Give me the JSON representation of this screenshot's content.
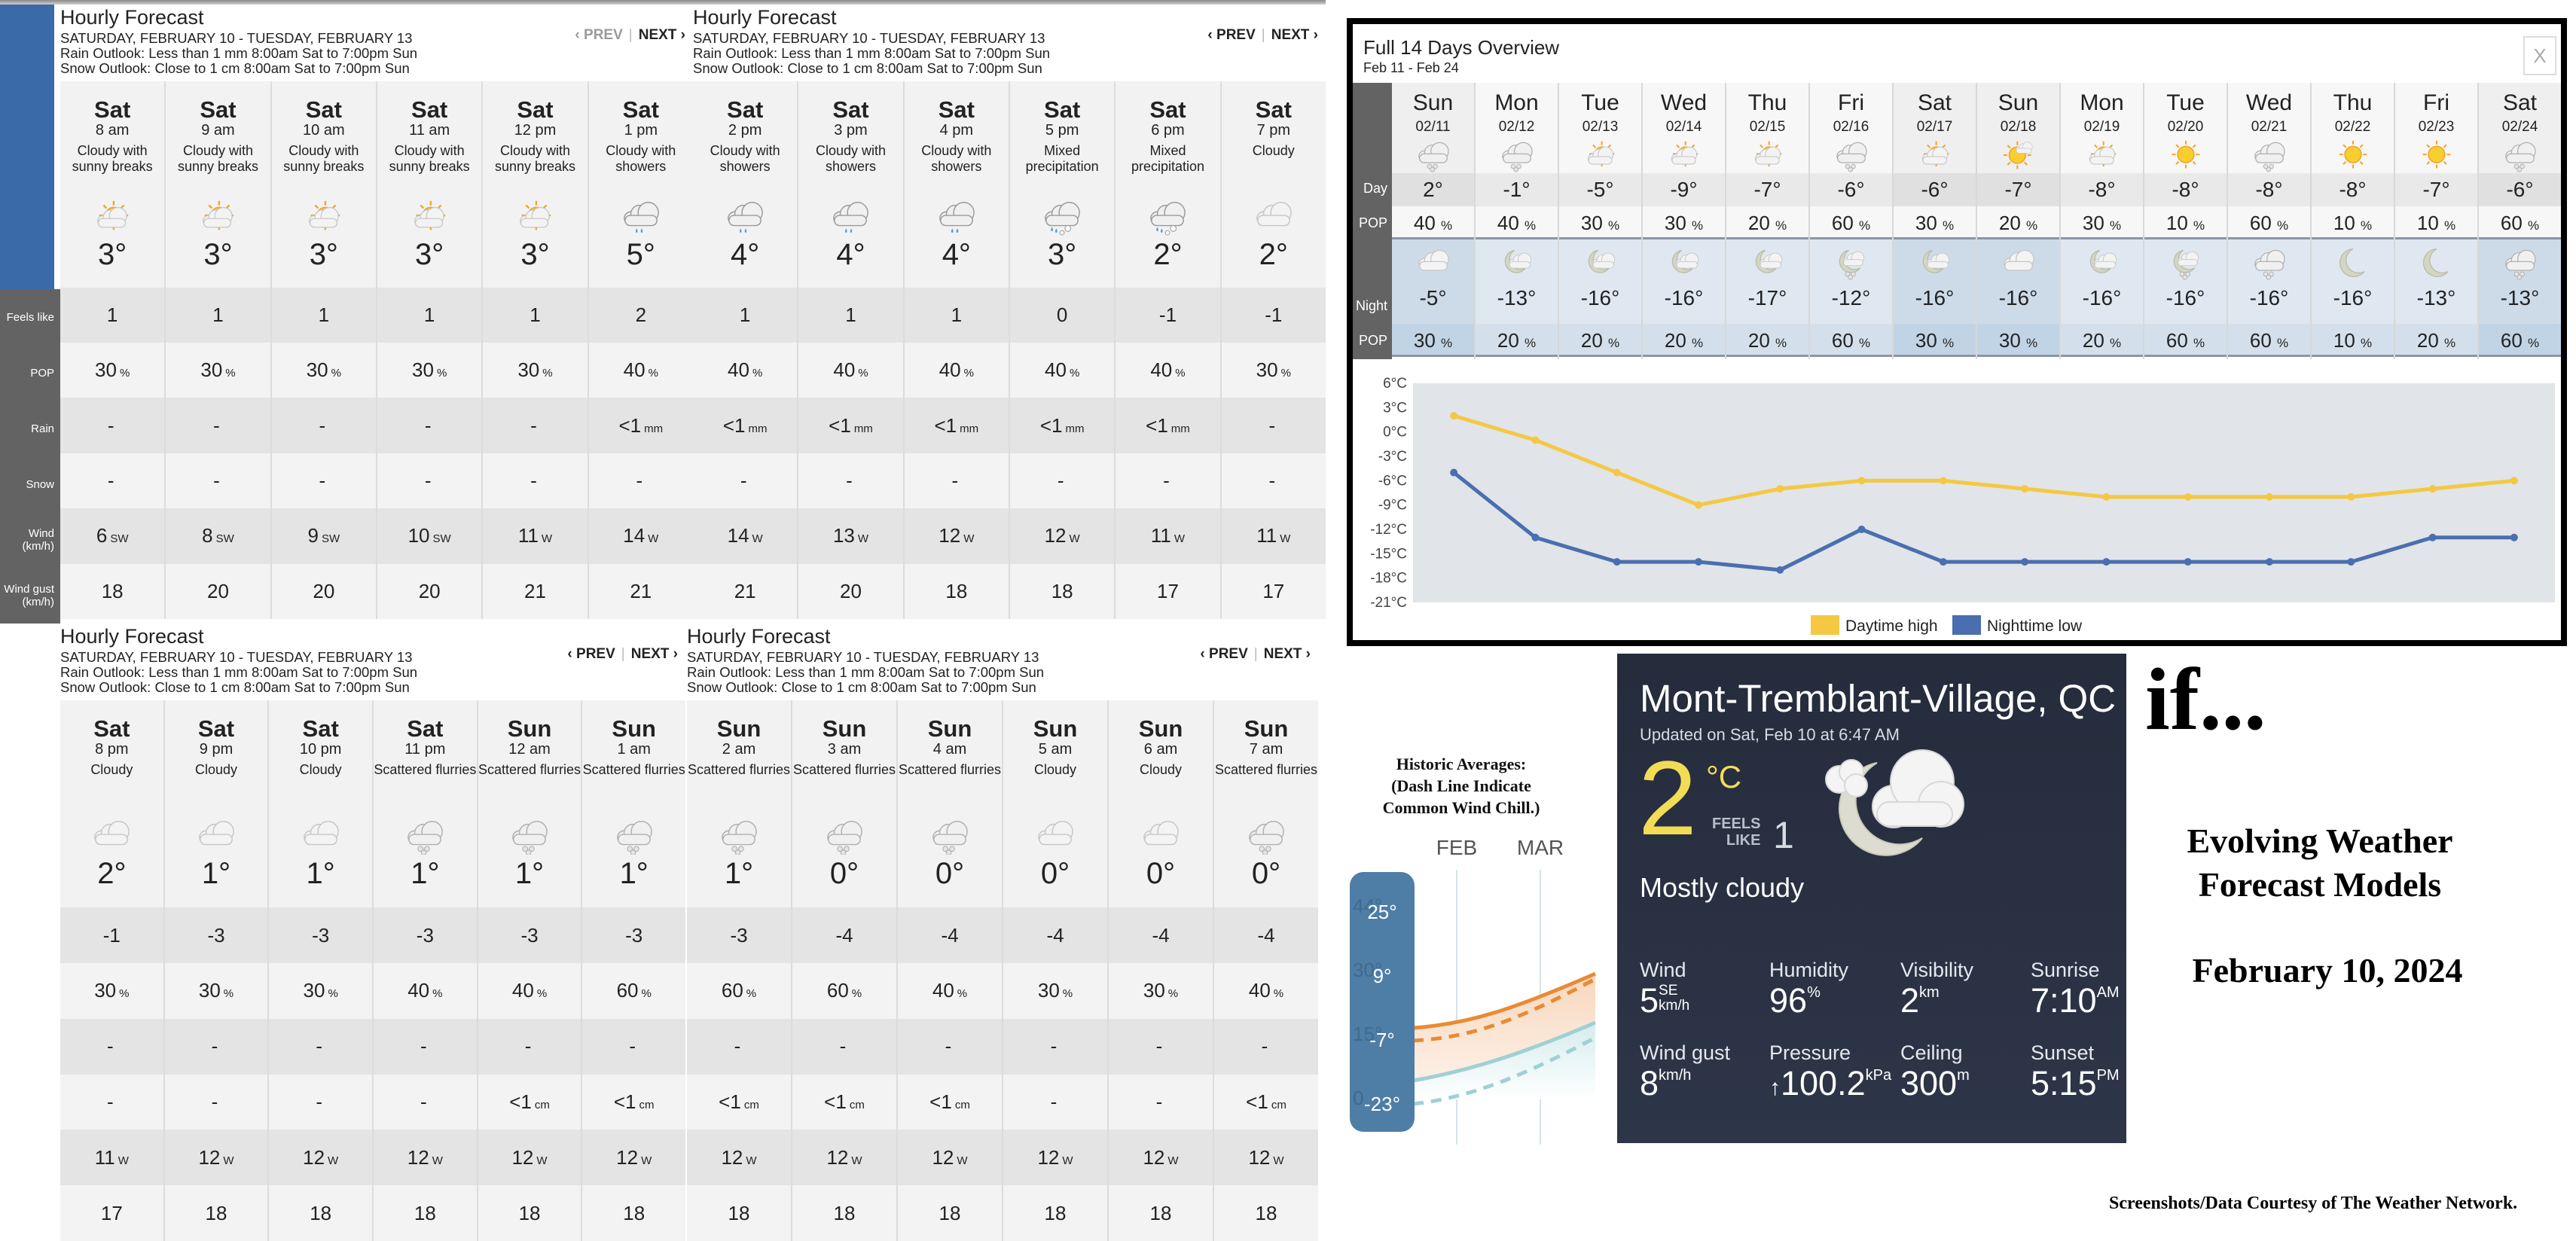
{
  "hourly_panels": [
    {
      "title": "Hourly Forecast",
      "date_range": "SATURDAY, FEBRUARY 10 - TUESDAY, FEBRUARY 13",
      "rain_outlook": "Rain Outlook: Less than 1 mm 8:00am Sat to 7:00pm Sun",
      "snow_outlook": "Snow Outlook: Close to 1 cm 8:00am Sat to 7:00pm Sun",
      "prev_label": "‹ PREV",
      "next_label": "NEXT ›",
      "prev_disabled": true,
      "hours": [
        {
          "day": "Sat",
          "time": "8 am",
          "condition": "Cloudy with\nsunny breaks",
          "icon": "partly-sunny-icon",
          "temp": "3°",
          "feels": "1",
          "pop": "30",
          "rain": "-",
          "rain_unit": "",
          "snow": "-",
          "snow_unit": "",
          "wind": "6",
          "wind_dir": "SW",
          "gust": "18"
        },
        {
          "day": "Sat",
          "time": "9 am",
          "condition": "Cloudy with\nsunny breaks",
          "icon": "partly-sunny-icon",
          "temp": "3°",
          "feels": "1",
          "pop": "30",
          "rain": "-",
          "rain_unit": "",
          "snow": "-",
          "snow_unit": "",
          "wind": "8",
          "wind_dir": "SW",
          "gust": "20"
        },
        {
          "day": "Sat",
          "time": "10 am",
          "condition": "Cloudy with\nsunny breaks",
          "icon": "partly-sunny-icon",
          "temp": "3°",
          "feels": "1",
          "pop": "30",
          "rain": "-",
          "rain_unit": "",
          "snow": "-",
          "snow_unit": "",
          "wind": "9",
          "wind_dir": "SW",
          "gust": "20"
        },
        {
          "day": "Sat",
          "time": "11 am",
          "condition": "Cloudy with\nsunny breaks",
          "icon": "partly-sunny-icon",
          "temp": "3°",
          "feels": "1",
          "pop": "30",
          "rain": "-",
          "rain_unit": "",
          "snow": "-",
          "snow_unit": "",
          "wind": "10",
          "wind_dir": "SW",
          "gust": "20"
        },
        {
          "day": "Sat",
          "time": "12 pm",
          "condition": "Cloudy with\nsunny breaks",
          "icon": "partly-sunny-icon",
          "temp": "3°",
          "feels": "1",
          "pop": "30",
          "rain": "-",
          "rain_unit": "",
          "snow": "-",
          "snow_unit": "",
          "wind": "11",
          "wind_dir": "W",
          "gust": "21"
        },
        {
          "day": "Sat",
          "time": "1 pm",
          "condition": "Cloudy with\nshowers",
          "icon": "rain-cloud-icon",
          "temp": "5°",
          "feels": "2",
          "pop": "40",
          "rain": "<1",
          "rain_unit": "mm",
          "snow": "-",
          "snow_unit": "",
          "wind": "14",
          "wind_dir": "W",
          "gust": "21"
        }
      ]
    },
    {
      "title": "Hourly Forecast",
      "date_range": "SATURDAY, FEBRUARY 10 - TUESDAY, FEBRUARY 13",
      "rain_outlook": "Rain Outlook: Less than 1 mm 8:00am Sat to 7:00pm Sun",
      "snow_outlook": "Snow Outlook: Close to 1 cm 8:00am Sat to 7:00pm Sun",
      "prev_label": "‹ PREV",
      "next_label": "NEXT ›",
      "prev_disabled": false,
      "hours": [
        {
          "day": "Sat",
          "time": "2 pm",
          "condition": "Cloudy with\nshowers",
          "icon": "rain-cloud-icon",
          "temp": "4°",
          "feels": "1",
          "pop": "40",
          "rain": "<1",
          "rain_unit": "mm",
          "snow": "-",
          "snow_unit": "",
          "wind": "14",
          "wind_dir": "W",
          "gust": "21"
        },
        {
          "day": "Sat",
          "time": "3 pm",
          "condition": "Cloudy with\nshowers",
          "icon": "rain-cloud-icon",
          "temp": "4°",
          "feels": "1",
          "pop": "40",
          "rain": "<1",
          "rain_unit": "mm",
          "snow": "-",
          "snow_unit": "",
          "wind": "13",
          "wind_dir": "W",
          "gust": "20"
        },
        {
          "day": "Sat",
          "time": "4 pm",
          "condition": "Cloudy with\nshowers",
          "icon": "rain-cloud-icon",
          "temp": "4°",
          "feels": "1",
          "pop": "40",
          "rain": "<1",
          "rain_unit": "mm",
          "snow": "-",
          "snow_unit": "",
          "wind": "12",
          "wind_dir": "W",
          "gust": "18"
        },
        {
          "day": "Sat",
          "time": "5 pm",
          "condition": "Mixed\nprecipitation",
          "icon": "mixed-precip-icon",
          "temp": "3°",
          "feels": "0",
          "pop": "40",
          "rain": "<1",
          "rain_unit": "mm",
          "snow": "-",
          "snow_unit": "",
          "wind": "12",
          "wind_dir": "W",
          "gust": "18"
        },
        {
          "day": "Sat",
          "time": "6 pm",
          "condition": "Mixed\nprecipitation",
          "icon": "mixed-precip-icon",
          "temp": "2°",
          "feels": "-1",
          "pop": "40",
          "rain": "<1",
          "rain_unit": "mm",
          "snow": "-",
          "snow_unit": "",
          "wind": "11",
          "wind_dir": "W",
          "gust": "17"
        },
        {
          "day": "Sat",
          "time": "7 pm",
          "condition": "Cloudy",
          "icon": "cloud-icon",
          "temp": "2°",
          "feels": "-1",
          "pop": "30",
          "rain": "-",
          "rain_unit": "",
          "snow": "-",
          "snow_unit": "",
          "wind": "11",
          "wind_dir": "W",
          "gust": "17"
        }
      ]
    },
    {
      "title": "Hourly Forecast",
      "date_range": "SATURDAY, FEBRUARY 10 - TUESDAY, FEBRUARY 13",
      "rain_outlook": "Rain Outlook: Less than 1 mm 8:00am Sat to 7:00pm Sun",
      "snow_outlook": "Snow Outlook: Close to 1 cm 8:00am Sat to 7:00pm Sun",
      "prev_label": "‹ PREV",
      "next_label": "NEXT ›",
      "prev_disabled": false,
      "hours": [
        {
          "day": "Sat",
          "time": "8 pm",
          "condition": "Cloudy",
          "icon": "cloud-icon",
          "temp": "2°",
          "feels": "-1",
          "pop": "30",
          "rain": "-",
          "rain_unit": "",
          "snow": "-",
          "snow_unit": "",
          "wind": "11",
          "wind_dir": "W",
          "gust": "17"
        },
        {
          "day": "Sat",
          "time": "9 pm",
          "condition": "Cloudy",
          "icon": "cloud-icon",
          "temp": "1°",
          "feels": "-3",
          "pop": "30",
          "rain": "-",
          "rain_unit": "",
          "snow": "-",
          "snow_unit": "",
          "wind": "12",
          "wind_dir": "W",
          "gust": "18"
        },
        {
          "day": "Sat",
          "time": "10 pm",
          "condition": "Cloudy",
          "icon": "cloud-icon",
          "temp": "1°",
          "feels": "-3",
          "pop": "30",
          "rain": "-",
          "rain_unit": "",
          "snow": "-",
          "snow_unit": "",
          "wind": "12",
          "wind_dir": "W",
          "gust": "18"
        },
        {
          "day": "Sat",
          "time": "11 pm",
          "condition": "Scattered flurries",
          "icon": "flurries-icon",
          "temp": "1°",
          "feels": "-3",
          "pop": "40",
          "rain": "-",
          "rain_unit": "",
          "snow": "-",
          "snow_unit": "",
          "wind": "12",
          "wind_dir": "W",
          "gust": "18"
        },
        {
          "day": "Sun",
          "time": "12 am",
          "condition": "Scattered flurries",
          "icon": "flurries-icon",
          "temp": "1°",
          "feels": "-3",
          "pop": "40",
          "rain": "-",
          "rain_unit": "",
          "snow": "<1",
          "snow_unit": "cm",
          "wind": "12",
          "wind_dir": "W",
          "gust": "18"
        },
        {
          "day": "Sun",
          "time": "1 am",
          "condition": "Scattered flurries",
          "icon": "flurries-icon",
          "temp": "1°",
          "feels": "-3",
          "pop": "60",
          "rain": "-",
          "rain_unit": "",
          "snow": "<1",
          "snow_unit": "cm",
          "wind": "12",
          "wind_dir": "W",
          "gust": "18"
        }
      ]
    },
    {
      "title": "Hourly Forecast",
      "date_range": "SATURDAY, FEBRUARY 10 - TUESDAY, FEBRUARY 13",
      "rain_outlook": "Rain Outlook: Less than 1 mm 8:00am Sat to 7:00pm Sun",
      "snow_outlook": "Snow Outlook: Close to 1 cm 8:00am Sat to 7:00pm Sun",
      "prev_label": "‹ PREV",
      "next_label": "NEXT ›",
      "prev_disabled": false,
      "hours": [
        {
          "day": "Sun",
          "time": "2 am",
          "condition": "Scattered flurries",
          "icon": "flurries-icon",
          "temp": "1°",
          "feels": "-3",
          "pop": "60",
          "rain": "-",
          "rain_unit": "",
          "snow": "<1",
          "snow_unit": "cm",
          "wind": "12",
          "wind_dir": "W",
          "gust": "18"
        },
        {
          "day": "Sun",
          "time": "3 am",
          "condition": "Scattered flurries",
          "icon": "flurries-icon",
          "temp": "0°",
          "feels": "-4",
          "pop": "60",
          "rain": "-",
          "rain_unit": "",
          "snow": "<1",
          "snow_unit": "cm",
          "wind": "12",
          "wind_dir": "W",
          "gust": "18"
        },
        {
          "day": "Sun",
          "time": "4 am",
          "condition": "Scattered flurries",
          "icon": "flurries-icon",
          "temp": "0°",
          "feels": "-4",
          "pop": "40",
          "rain": "-",
          "rain_unit": "",
          "snow": "<1",
          "snow_unit": "cm",
          "wind": "12",
          "wind_dir": "W",
          "gust": "18"
        },
        {
          "day": "Sun",
          "time": "5 am",
          "condition": "Cloudy",
          "icon": "cloud-icon",
          "temp": "0°",
          "feels": "-4",
          "pop": "30",
          "rain": "-",
          "rain_unit": "",
          "snow": "-",
          "snow_unit": "",
          "wind": "12",
          "wind_dir": "W",
          "gust": "18"
        },
        {
          "day": "Sun",
          "time": "6 am",
          "condition": "Cloudy",
          "icon": "cloud-icon",
          "temp": "0°",
          "feels": "-4",
          "pop": "30",
          "rain": "-",
          "rain_unit": "",
          "snow": "-",
          "snow_unit": "",
          "wind": "12",
          "wind_dir": "W",
          "gust": "18"
        },
        {
          "day": "Sun",
          "time": "7 am",
          "condition": "Scattered flurries",
          "icon": "flurries-icon",
          "temp": "0°",
          "feels": "-4",
          "pop": "40",
          "rain": "-",
          "rain_unit": "",
          "snow": "<1",
          "snow_unit": "cm",
          "wind": "12",
          "wind_dir": "W",
          "gust": "18"
        }
      ]
    }
  ],
  "row_labels": {
    "feels_like": "Feels like",
    "pop": "POP",
    "rain": "Rain",
    "snow": "Snow",
    "wind": "Wind\n(km/h)",
    "gust": "Wind gust\n(km/h)",
    "pct": "%"
  },
  "overview14": {
    "title": "Full 14 Days Overview",
    "subtitle": "Feb 11 - Feb 24",
    "close_label": "X",
    "labels": {
      "day": "Day",
      "pop": "POP",
      "night": "Night"
    },
    "days": [
      {
        "dow": "Sun",
        "date": "02/11",
        "day_icon": "flurries-icon",
        "hi": "2°",
        "day_pop": "40",
        "night_icon": "cloud-icon",
        "lo": "-5°",
        "night_pop": "30",
        "highlight": true
      },
      {
        "dow": "Mon",
        "date": "02/12",
        "day_icon": "flurries-icon",
        "hi": "-1°",
        "day_pop": "40",
        "night_icon": "moon-cloud-icon",
        "lo": "-13°",
        "night_pop": "20",
        "highlight": false
      },
      {
        "dow": "Tue",
        "date": "02/13",
        "day_icon": "partly-sunny-icon",
        "hi": "-5°",
        "day_pop": "30",
        "night_icon": "moon-cloud-icon",
        "lo": "-16°",
        "night_pop": "20",
        "highlight": false
      },
      {
        "dow": "Wed",
        "date": "02/14",
        "day_icon": "partly-sunny-icon",
        "hi": "-9°",
        "day_pop": "30",
        "night_icon": "moon-cloud-icon",
        "lo": "-16°",
        "night_pop": "20",
        "highlight": false
      },
      {
        "dow": "Thu",
        "date": "02/15",
        "day_icon": "partly-sunny-icon",
        "hi": "-7°",
        "day_pop": "20",
        "night_icon": "moon-cloud-icon",
        "lo": "-17°",
        "night_pop": "20",
        "highlight": false
      },
      {
        "dow": "Fri",
        "date": "02/16",
        "day_icon": "flurries-icon",
        "hi": "-6°",
        "day_pop": "60",
        "night_icon": "moon-flurries-icon",
        "lo": "-12°",
        "night_pop": "60",
        "highlight": false
      },
      {
        "dow": "Sat",
        "date": "02/17",
        "day_icon": "partly-sunny-icon",
        "hi": "-6°",
        "day_pop": "30",
        "night_icon": "moon-cloud-icon",
        "lo": "-16°",
        "night_pop": "30",
        "highlight": true
      },
      {
        "dow": "Sun",
        "date": "02/18",
        "day_icon": "sun-cloud-icon",
        "hi": "-7°",
        "day_pop": "20",
        "night_icon": "cloud-icon",
        "lo": "-16°",
        "night_pop": "30",
        "highlight": true
      },
      {
        "dow": "Mon",
        "date": "02/19",
        "day_icon": "partly-sunny-icon",
        "hi": "-8°",
        "day_pop": "30",
        "night_icon": "moon-cloud-icon",
        "lo": "-16°",
        "night_pop": "20",
        "highlight": false
      },
      {
        "dow": "Tue",
        "date": "02/20",
        "day_icon": "sun-icon",
        "hi": "-8°",
        "day_pop": "10",
        "night_icon": "moon-flurries-icon",
        "lo": "-16°",
        "night_pop": "60",
        "highlight": false
      },
      {
        "dow": "Wed",
        "date": "02/21",
        "day_icon": "flurries-icon",
        "hi": "-8°",
        "day_pop": "60",
        "night_icon": "flurries-icon",
        "lo": "-16°",
        "night_pop": "60",
        "highlight": false
      },
      {
        "dow": "Thu",
        "date": "02/22",
        "day_icon": "sun-icon",
        "hi": "-8°",
        "day_pop": "10",
        "night_icon": "moon-icon",
        "lo": "-16°",
        "night_pop": "10",
        "highlight": false
      },
      {
        "dow": "Fri",
        "date": "02/23",
        "day_icon": "sun-icon",
        "hi": "-7°",
        "day_pop": "10",
        "night_icon": "moon-icon",
        "lo": "-13°",
        "night_pop": "20",
        "highlight": false
      },
      {
        "dow": "Sat",
        "date": "02/24",
        "day_icon": "flurries-icon",
        "hi": "-6°",
        "day_pop": "60",
        "night_icon": "flurries-icon",
        "lo": "-13°",
        "night_pop": "60",
        "highlight": true
      }
    ]
  },
  "chart_data": {
    "type": "line",
    "title": "",
    "xlabel": "",
    "ylabel": "",
    "x": [
      "02/11",
      "02/12",
      "02/13",
      "02/14",
      "02/15",
      "02/16",
      "02/17",
      "02/18",
      "02/19",
      "02/20",
      "02/21",
      "02/22",
      "02/23",
      "02/24"
    ],
    "yticks": [
      "6°C",
      "3°C",
      "0°C",
      "-3°C",
      "-6°C",
      "-9°C",
      "-12°C",
      "-15°C",
      "-18°C",
      "-21°C"
    ],
    "ylim": [
      -21,
      6
    ],
    "grid": false,
    "legend_position": "bottom-center",
    "series": [
      {
        "name": "Daytime high",
        "color": "#f4c842",
        "values": [
          2,
          -1,
          -5,
          -9,
          -7,
          -6,
          -6,
          -7,
          -8,
          -8,
          -8,
          -8,
          -7,
          -6
        ]
      },
      {
        "name": "Nighttime low",
        "color": "#4a6fb0",
        "values": [
          -5,
          -13,
          -16,
          -16,
          -17,
          -12,
          -16,
          -16,
          -16,
          -16,
          -16,
          -16,
          -13,
          -13
        ]
      }
    ]
  },
  "historic": {
    "title": "Historic Averages:\n(Dash Line Indicate\nCommon Wind Chill.)",
    "months": [
      "FEB",
      "MAR"
    ],
    "scale_labels": [
      "25°",
      "9°",
      "-7°",
      "-23°"
    ],
    "faded_labels": [
      "44°",
      "30°",
      "15°",
      "0"
    ]
  },
  "current": {
    "location": "Mont-Tremblant-Village, QC",
    "updated": "Updated on Sat, Feb 10 at 6:47 AM",
    "temp": "2",
    "unit": "°C",
    "feels_label_1": "FEELS",
    "feels_label_2": "LIKE",
    "feels_value": "1",
    "condition": "Mostly cloudy",
    "icon": "moon-cloud-icon",
    "stats": {
      "wind": {
        "label": "Wind",
        "value": "5",
        "dir": "SE",
        "unit": "km/h"
      },
      "humidity": {
        "label": "Humidity",
        "value": "96",
        "unit": "%"
      },
      "visibility": {
        "label": "Visibility",
        "value": "2",
        "unit": "km"
      },
      "sunrise": {
        "label": "Sunrise",
        "value": "7:10",
        "unit": "AM"
      },
      "gust": {
        "label": "Wind gust",
        "value": "8",
        "unit": "km/h"
      },
      "pressure": {
        "label": "Pressure",
        "arrow": "↑",
        "value": "100.2",
        "unit": "kPa"
      },
      "ceiling": {
        "label": "Ceiling",
        "value": "300",
        "unit": "m"
      },
      "sunset": {
        "label": "Sunset",
        "value": "5:15",
        "unit": "PM"
      }
    }
  },
  "titles": {
    "if": "if...",
    "headline": "Evolving Weather\nForecast Models",
    "date": "February 10, 2024",
    "credit": "Screenshots/Data Courtesy of The Weather Network."
  }
}
